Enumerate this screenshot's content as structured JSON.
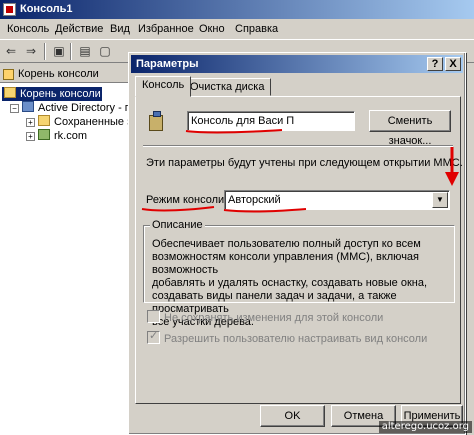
{
  "window": {
    "title": "Консоль1"
  },
  "menu": [
    "Консоль",
    "Действие",
    "Вид",
    "Избранное",
    "Окно",
    "Справка"
  ],
  "toolbar": {
    "icons": [
      "back-icon",
      "forward-icon",
      "up-icon",
      "properties-icon"
    ]
  },
  "tree": {
    "header": "Корень консоли",
    "items": [
      {
        "label": "Корень консоли",
        "icon": "folder-icon"
      },
      {
        "label": "Active Directory - пол",
        "icon": "active-directory-icon"
      },
      {
        "label": "Сохраненные за",
        "icon": "folder-icon"
      },
      {
        "label": "rk.com",
        "icon": "domain-icon"
      }
    ]
  },
  "dialog": {
    "title": "Параметры",
    "help_label": "?",
    "close_label": "X",
    "tabs": [
      "Консоль",
      "Очистка диска"
    ],
    "console_name": "Консоль для Васи П",
    "change_icon_label": "Сменить значок...",
    "info_text": "Эти параметры будут учтены при следующем открытии MMC.",
    "mode_label": "Режим консоли:",
    "mode_value": "Авторский",
    "description_legend": "Описание",
    "description_text": "Обеспечивает пользователю полный доступ ко всем\nвозможностям консоли управления (MMC), включая возможность\nдобавлять и удалять оснастку, создавать новые окна,\nсоздавать виды панели задач и задачи, а также просматривать\nвсе участки дерева.",
    "checkbox_no_save": "Не сохранять изменения для этой консоли",
    "checkbox_allow_customize": "Разрешить пользователю настраивать вид консоли",
    "ok_label": "OK",
    "cancel_label": "Отмена",
    "apply_label": "Применить"
  },
  "annotations": {
    "color": "#e00000"
  },
  "watermark": "alterego.ucoz.org"
}
